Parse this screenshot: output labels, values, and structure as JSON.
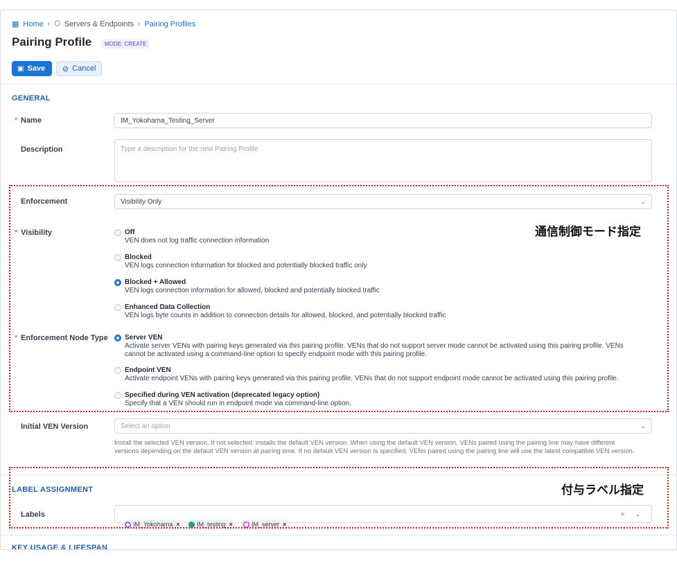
{
  "breadcrumb": {
    "home": "Home",
    "servers": "Servers & Endpoints",
    "current": "Pairing Profiles"
  },
  "page": {
    "title": "Pairing Profile",
    "mode": "MODE: CREATE"
  },
  "toolbar": {
    "save": "Save",
    "cancel": "Cancel"
  },
  "general": {
    "heading": "GENERAL",
    "name_label": "Name",
    "name_value": "IM_Yokohama_Testing_Server",
    "description_label": "Description",
    "description_placeholder": "Type a description for the new Pairing Profile"
  },
  "enforcement": {
    "label": "Enforcement",
    "value": "Visibility Only"
  },
  "visibility": {
    "label": "Visibility",
    "options": [
      {
        "title": "Off",
        "desc": "VEN does not log traffic connection information",
        "selected": false
      },
      {
        "title": "Blocked",
        "desc": "VEN logs connection information for blocked and potentially blocked traffic only",
        "selected": false
      },
      {
        "title": "Blocked + Allowed",
        "desc": "VEN logs connection information for allowed, blocked and potentially blocked traffic",
        "selected": true
      },
      {
        "title": "Enhanced Data Collection",
        "desc": "VEN logs byte counts in addition to connection details for allowed, blocked, and potentially blocked traffic",
        "selected": false
      }
    ]
  },
  "node_type": {
    "label": "Enforcement Node Type",
    "options": [
      {
        "title": "Server VEN",
        "desc": "Activate server VENs with pairing keys generated via this pairing profile. VENs that do not support server mode cannot be activated using this pairing profile. VENs cannot be activated using a command-line option to specify endpoint mode with this pairing profile.",
        "selected": true
      },
      {
        "title": "Endpoint VEN",
        "desc": "Activate endpoint VENs with pairing keys generated via this pairing profile. VENs that do not support endpoint mode cannot be activated using this pairing profile.",
        "selected": false
      },
      {
        "title": "Specified during VEN activation (deprecated legacy option)",
        "desc": "Specify that a VEN should run in endpoint mode via command-line option.",
        "selected": false
      }
    ]
  },
  "initial_version": {
    "label": "Initial VEN Version",
    "placeholder": "Select an option",
    "help": "Install the selected VEN version. If not selected, installs the default VEN version. When using the default VEN version, VENs paired using the pairing line may have different versions depending on the default VEN version at pairing time. If no default VEN version is specified, VENs paired using the pairing line will use the latest compatible VEN version."
  },
  "label_assignment": {
    "heading": "LABEL ASSIGNMENT",
    "labels_label": "Labels",
    "chips": [
      "IM_Yokohama",
      "IM_testing",
      "IM_server"
    ]
  },
  "key_usage": {
    "heading": "KEY USAGE & LIFESPAN"
  },
  "annotations": {
    "mode_note": "通信制御モード指定",
    "label_note": "付与ラベル指定"
  },
  "colors": {
    "accent": "#1a73d6",
    "annotation_border": "#e0161b",
    "section_heading": "#1f5fa8"
  },
  "icons": [
    "home-grid-icon",
    "server-icon",
    "save-icon",
    "cancel-icon",
    "chevron-down-icon",
    "clear-icon",
    "close-icon"
  ]
}
